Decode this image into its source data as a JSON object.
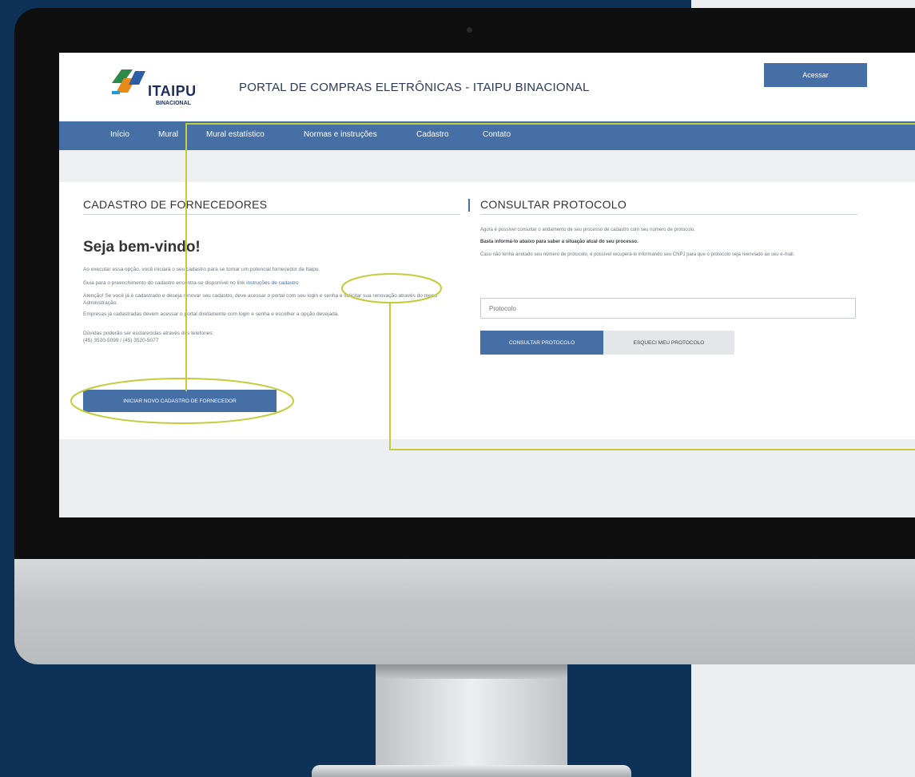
{
  "brand": {
    "logo_name": "ITAIPU",
    "logo_sub": "BINACIONAL",
    "portal_title": "PORTAL DE COMPRAS ELETRÔNICAS - ITAIPU BINACIONAL",
    "access_label": "Acessar"
  },
  "nav": [
    "Início",
    "Mural",
    "Mural estatístico",
    "Normas e instruções",
    "Cadastro",
    "Contato"
  ],
  "left": {
    "heading": "CADASTRO DE FORNECEDORES",
    "welcome": "Seja bem-vindo!",
    "p1": "Ao executar essa opção, você iniciará o seu cadastro para se tornar um potencial fornecedor da Itaipu.",
    "p2_pre": "Guia para o preenchimento do cadastro encontra-se disponível no link ",
    "p2_link": "instruções de cadastro",
    "p3": "Atenção! Se você já é cadastrado e deseja renovar seu cadastro, deve acessar o portal com seu login e senha e solicitar sua renovação através do menu Administração.",
    "p4": "Empresas já cadastradas devem acessar o portal diretamente com login e senha e escolher a opção desejada.",
    "p5": "Dúvidas poderão ser esclarecidas através dos telefones:",
    "phones": "(45) 3520-5099 / (45) 3520-5077",
    "start_btn": "INICIAR NOVO CADASTRO DE FORNECEDOR"
  },
  "right": {
    "heading": "CONSULTAR PROTOCOLO",
    "p1": "Agora é possível consultar o andamento de seu processo de cadastro com seu número de protocolo.",
    "p2": "Basta informá-lo abaixo para saber a situação atual do seu processo.",
    "p3": "Caso não tenha anotado seu número de protocolo, é possível recuperá-lo informando seu CNPJ para que o protocolo seja reenviado ao seu e-mail.",
    "input_placeholder": "Protocolo",
    "consult_btn": "CONSULTAR PROTOCOLO",
    "forgot_btn": "ESQUECI MEU PROTOCOLO"
  },
  "colors": {
    "accent": "#4670a5",
    "highlight": "#c3cc3a",
    "page_bg": "#0d3157"
  }
}
